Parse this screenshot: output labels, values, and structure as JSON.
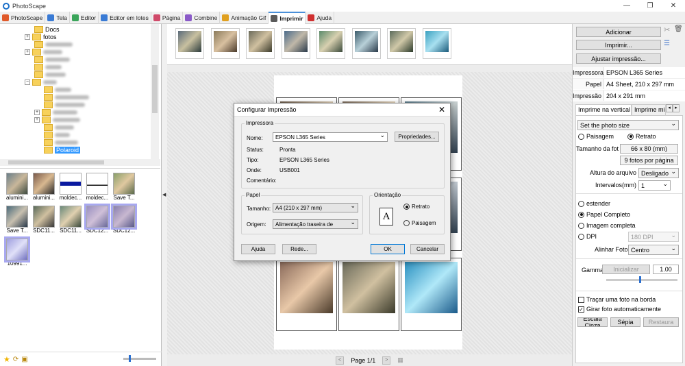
{
  "app": {
    "title": "PhotoScape"
  },
  "window": {
    "minimize": "—",
    "maximize": "❐",
    "close": "✕"
  },
  "tabs": [
    {
      "label": "PhotoScape",
      "color": "#e05a2a"
    },
    {
      "label": "Tela",
      "color": "#3a7bd5"
    },
    {
      "label": "Editor",
      "color": "#3aa55a"
    },
    {
      "label": "Editor em lotes",
      "color": "#3a7bd5"
    },
    {
      "label": "Página",
      "color": "#d04a6a"
    },
    {
      "label": "Combine",
      "color": "#8a5ac8"
    },
    {
      "label": "Animação Gif",
      "color": "#e0a020"
    },
    {
      "label": "Imprimir",
      "color": "#5a5a5a",
      "active": true
    },
    {
      "label": "Ajuda",
      "color": "#d03030"
    }
  ],
  "tree": {
    "items": [
      {
        "label": "Docs"
      },
      {
        "label": "fotos"
      },
      {
        "label": "Polaroid",
        "selected": true
      }
    ]
  },
  "thumbs": [
    {
      "label": "alumini..."
    },
    {
      "label": "alumini..."
    },
    {
      "label": "moldec..."
    },
    {
      "label": "moldec..."
    },
    {
      "label": "Save T..."
    },
    {
      "label": "Save T..."
    },
    {
      "label": "SDC11..."
    },
    {
      "label": "SDC11..."
    },
    {
      "label": "SDC12..."
    },
    {
      "label": "SDC12..."
    },
    {
      "label": "10991..."
    }
  ],
  "status": {
    "page": "Page 1/1"
  },
  "right": {
    "add": "Adicionar",
    "print": "Imprimir...",
    "adjust": "Ajustar impressão...",
    "info": [
      {
        "k": "Impressora",
        "v": "EPSON L365 Series"
      },
      {
        "k": "Papel",
        "v": "A4 Sheet, 210 x 297 mm"
      },
      {
        "k": "Impressão",
        "v": "204 x 291 mm"
      }
    ],
    "tab1": "Imprime na vertical",
    "tab2": "Imprime mi",
    "photo_size": "Set the photo size",
    "portrait_opt": "Paisagem",
    "landscape_opt": "Retrato",
    "photo_size_label": "Tamanho da foto",
    "photo_size_val": "66 x 80 (mm)",
    "per_page": "9 fotos por página",
    "height_label": "Altura do arquivo",
    "height_val": "Desligado",
    "interval_label": "Intervalos(mm)",
    "interval_val": "1",
    "opt_stretch": "estender",
    "opt_full_paper": "Papel Completo",
    "opt_full_image": "Imagem completa",
    "opt_dpi": "DPI",
    "dpi_val": "180 DPI",
    "align_label": "Alinhar Foto",
    "align_val": "Centro",
    "gamma_label": "Gamma",
    "gamma_init": "Inicializar",
    "gamma_val": "1.00",
    "chk_border": "Traçar uma foto na borda",
    "chk_rotate": "Girar foto automaticamente",
    "btn_gray": "Escala Cinza",
    "btn_sepia": "Sépia",
    "btn_restore": "Restaura"
  },
  "dialog": {
    "title": "Configurar Impressão",
    "printer_group": "Impressora",
    "name_label": "Nome:",
    "name_val": "EPSON L365 Series",
    "props_btn": "Propriedades...",
    "status_label": "Status:",
    "status_val": "Pronta",
    "type_label": "Tipo:",
    "type_val": "EPSON L365 Series",
    "where_label": "Onde:",
    "where_val": "USB001",
    "comment_label": "Comentário:",
    "paper_group": "Papel",
    "size_label": "Tamanho:",
    "size_val": "A4 (210 x 297 mm)",
    "source_label": "Origem:",
    "source_val": "Alimentação traseira de",
    "orient_group": "Orientação",
    "portrait": "Retrato",
    "landscape": "Paisagem",
    "help_btn": "Ajuda",
    "network_btn": "Rede...",
    "ok_btn": "OK",
    "cancel_btn": "Cancelar"
  }
}
